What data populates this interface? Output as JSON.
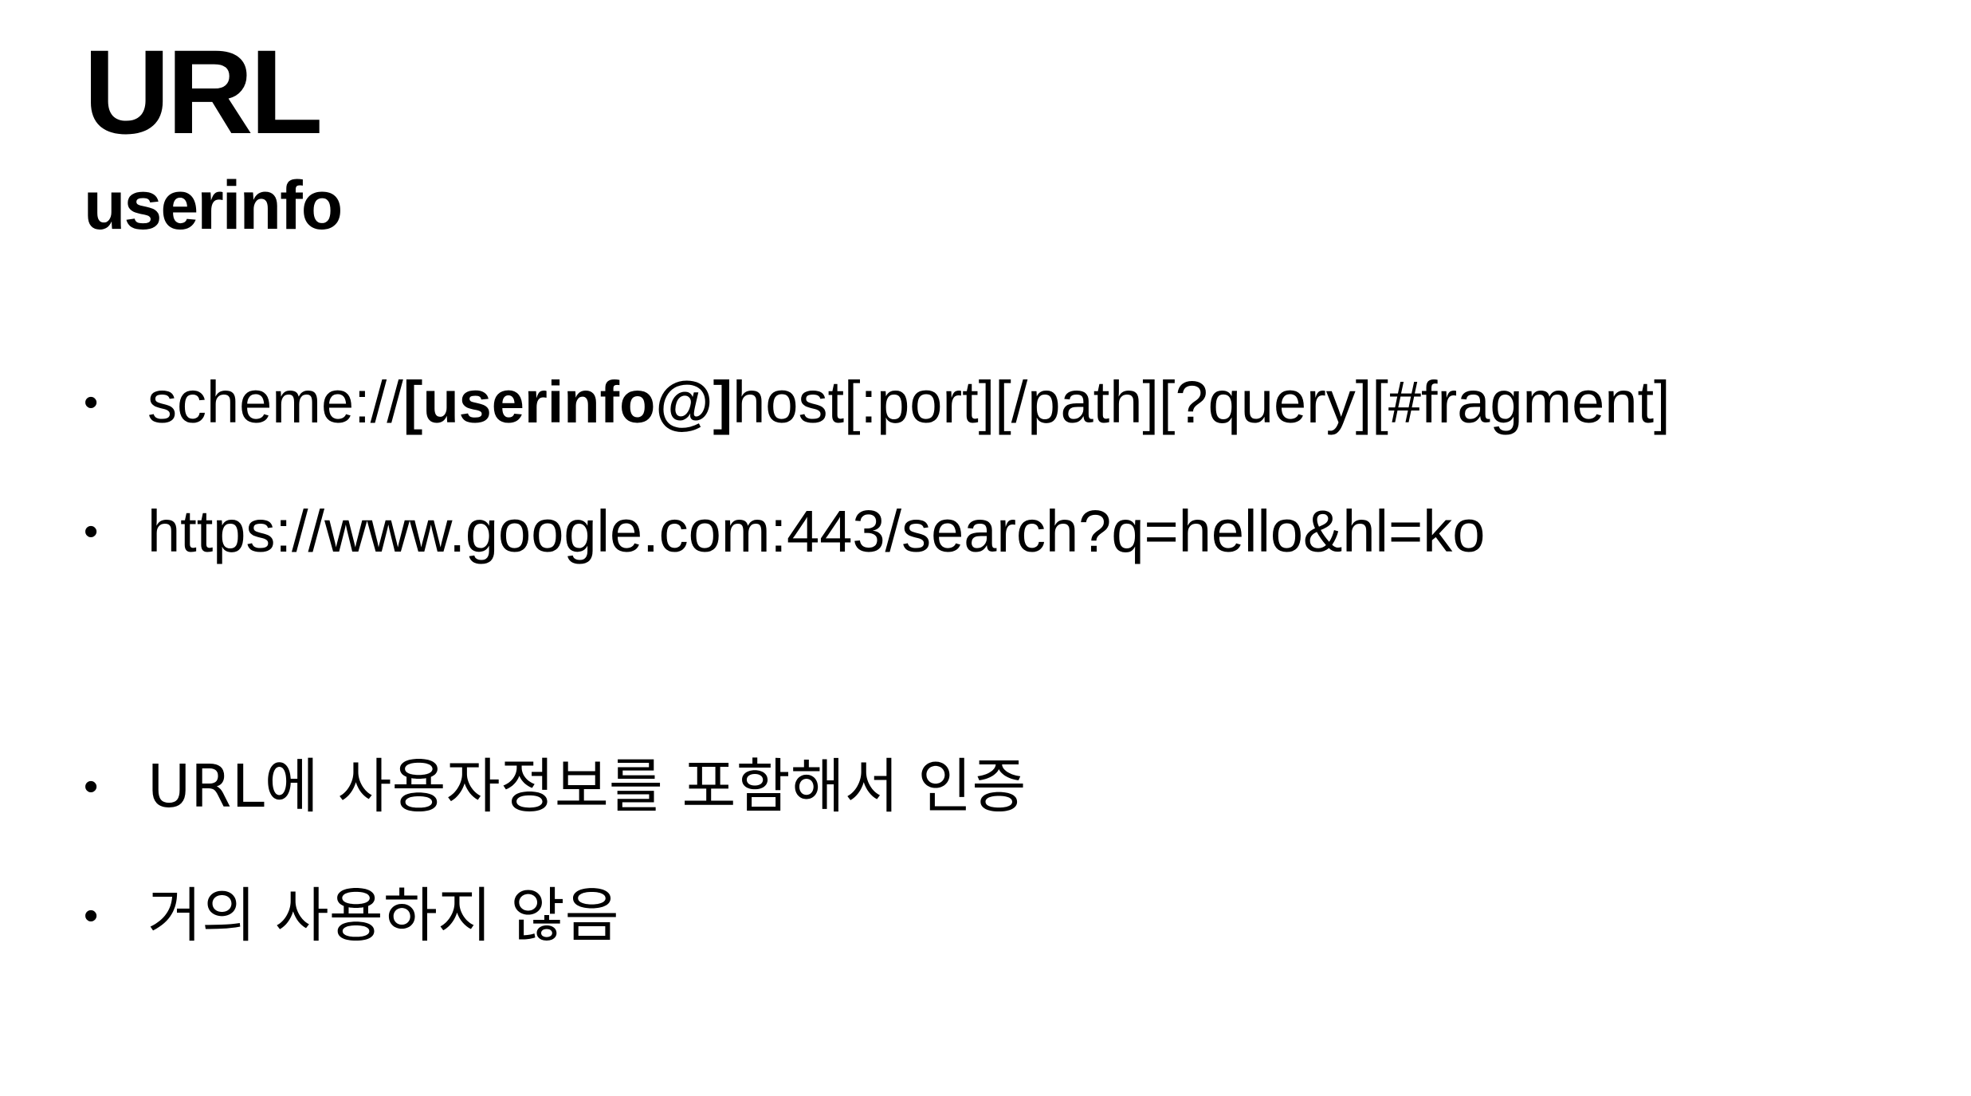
{
  "slide": {
    "title": "URL",
    "subtitle": "userinfo"
  },
  "bullets": {
    "bullet_symbol": "•",
    "syntax": {
      "prefix": "scheme://",
      "highlight": "[userinfo@]",
      "suffix": "host[:port][/path][?query][#fragment]"
    },
    "example": "https://www.google.com:443/search?q=hello&hl=ko",
    "note1": "URL에 사용자정보를 포함해서 인증",
    "note2": "거의 사용하지 않음"
  }
}
